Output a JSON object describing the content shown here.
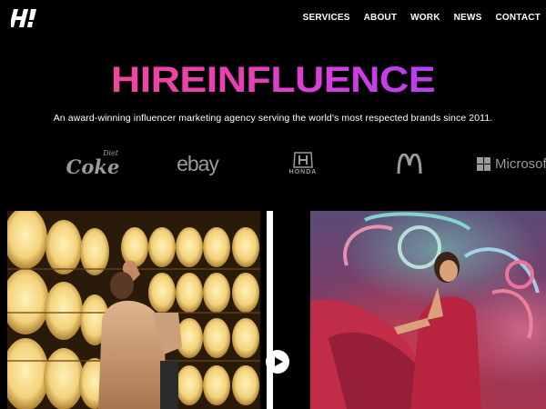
{
  "header": {
    "logo_text": "H!",
    "nav": [
      {
        "label": "SERVICES"
      },
      {
        "label": "ABOUT"
      },
      {
        "label": "WORK"
      },
      {
        "label": "NEWS"
      },
      {
        "label": "CONTACT"
      }
    ]
  },
  "hero": {
    "title": "HIREINFLUENCE",
    "tagline": "An award-winning influencer marketing agency serving the world's most respected brands since 2011."
  },
  "brands": {
    "coke": {
      "main": "Coke",
      "sub": "Diet"
    },
    "ebay": {
      "name": "ebay"
    },
    "honda": {
      "name": "HONDA"
    },
    "mcdonalds": {
      "icon": "mcdonalds-arches-icon"
    },
    "microsoft": {
      "name": "Microsoft"
    }
  },
  "gallery": {
    "play_icon": "play-icon"
  },
  "colors": {
    "background": "#000000",
    "title_gradient_start": "#f0469c",
    "title_gradient_end": "#b63ef0",
    "brand_gray": "#9a9a9a"
  }
}
